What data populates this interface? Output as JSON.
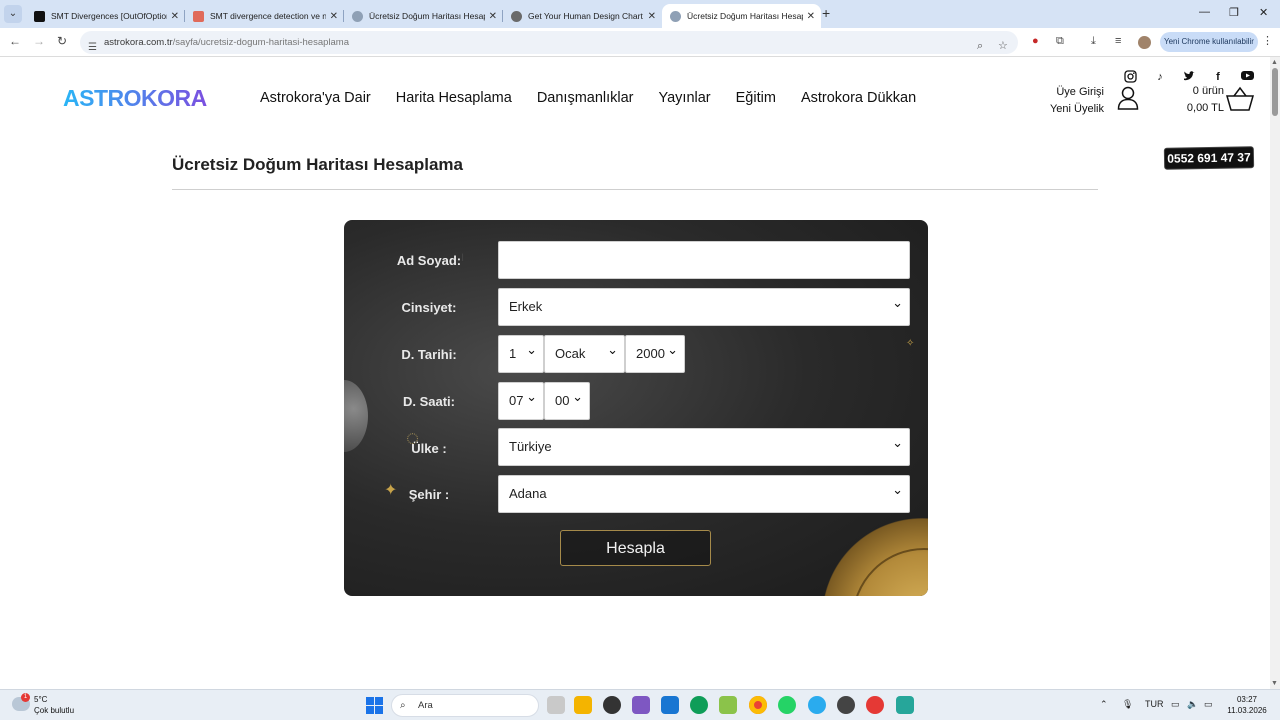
{
  "browser": {
    "tabs": [
      {
        "title": "SMT Divergences [OutOfOption",
        "favicon_color": "#111111",
        "active": false
      },
      {
        "title": "SMT divergence detection ve n",
        "favicon_color": "#e06a5a",
        "active": false
      },
      {
        "title": "Ücretsiz Doğum Haritası Hesap",
        "favicon_color": "#8fa0b5",
        "active": false
      },
      {
        "title": "Get Your Human Design Chart |",
        "favicon_color": "#6a6a6a",
        "active": false
      },
      {
        "title": "Ücretsiz Doğum Haritası Hesap",
        "favicon_color": "#8fa0b5",
        "active": true
      }
    ],
    "url_host": "astrokora.com.tr",
    "url_path": "/sayfa/ucretsiz-dogum-haritasi-hesaplama",
    "chrome_pill": "Yeni Chrome kullanılabilir"
  },
  "site": {
    "logo": "ASTROKORA",
    "nav": [
      "Astrokora'ya Dair",
      "Harita Hesaplama",
      "Danışmanlıklar",
      "Yayınlar",
      "Eğitim",
      "Astrokora Dükkan"
    ],
    "login": "Üye Girişi",
    "register": "Yeni Üyelik",
    "cart_count": "0 ürün",
    "cart_total": "0,00 TL",
    "phone": "0552 691 47 37",
    "social_icons": [
      "instagram-icon",
      "tiktok-icon",
      "twitter-icon",
      "facebook-icon",
      "youtube-icon"
    ]
  },
  "page": {
    "title": "Ücretsiz Doğum Haritası Hesaplama"
  },
  "form": {
    "name_label": "Ad Soyad:",
    "name_value": "",
    "gender_label": "Cinsiyet:",
    "gender_value": "Erkek",
    "date_label": "D. Tarihi:",
    "day_value": "1",
    "month_value": "Ocak",
    "year_value": "2000",
    "time_label": "D. Saati:",
    "hour_value": "07",
    "minute_value": "00",
    "country_label": "Ülke :",
    "country_value": "Türkiye",
    "city_label": "Şehir :",
    "city_value": "Adana",
    "submit_label": "Hesapla"
  },
  "taskbar": {
    "weather_temp": "5°C",
    "weather_desc": "Çok bulutlu",
    "weather_badge": "1",
    "search_label": "Ara",
    "lang": "TUR",
    "time": "03:27",
    "date": "11.03.2026"
  },
  "colors": {
    "logo_gradient_start": "#29b6f6",
    "logo_gradient_end": "#7b4fe0",
    "panel_bg": "#2a2a2a",
    "button_border": "#a58a4a"
  }
}
